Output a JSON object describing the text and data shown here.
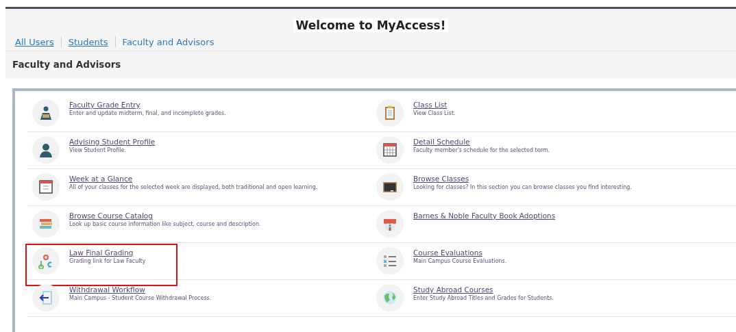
{
  "page_title": "Welcome to MyAccess!",
  "tabs": [
    {
      "label": "All Users",
      "selected": false
    },
    {
      "label": "Students",
      "selected": false
    },
    {
      "label": "Faculty and Advisors",
      "selected": true
    }
  ],
  "section_title": "Faculty and Advisors",
  "columns": [
    [
      {
        "title": "Faculty Grade Entry",
        "description": "Enter and update midterm, final, and incomplete grades.",
        "highlighted": false
      },
      {
        "title": "Advising Student Profile",
        "description": "View Student Profile.",
        "highlighted": false
      },
      {
        "title": "Week at a Glance",
        "description": "All of your classes for the selected week are displayed, both traditional and open learning.",
        "highlighted": false
      },
      {
        "title": "Browse Course Catalog",
        "description": "Look up basic course information like subject, course and description.",
        "highlighted": false
      },
      {
        "title": "Law Final Grading",
        "description": "Grading link for Law Faculty",
        "highlighted": true
      },
      {
        "title": "Withdrawal Workflow",
        "description": "Main Campus - Student Course Withdrawal Process.",
        "highlighted": false
      }
    ],
    [
      {
        "title": "Class List",
        "description": "View Class List.",
        "highlighted": false
      },
      {
        "title": "Detail Schedule",
        "description": "Faculty member's schedule for the selected term.",
        "highlighted": false
      },
      {
        "title": "Browse Classes",
        "description": "Looking for classes? In this section you can browse classes you find interesting.",
        "highlighted": false
      },
      {
        "title": "Barnes & Noble Faculty Book Adoptions",
        "highlighted": false
      },
      {
        "title": "Course Evaluations",
        "description": "Main Campus Course Evaluations.",
        "highlighted": false
      },
      {
        "title": "Study Abroad Courses",
        "description": "Enter Study Abroad Titles and Grades for Students.",
        "highlighted": false
      }
    ]
  ]
}
